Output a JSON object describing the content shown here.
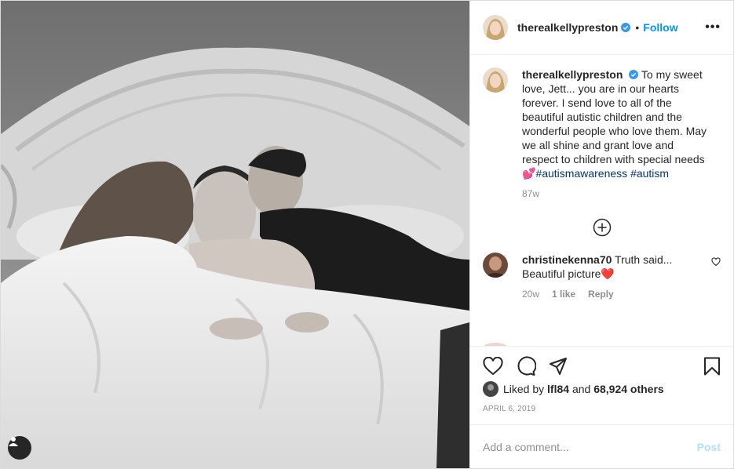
{
  "header": {
    "username": "therealkellypreston",
    "separator": "•",
    "follow_label": "Follow",
    "more_label": "•••"
  },
  "caption": {
    "username": "therealkellypreston",
    "text": "To my sweet love, Jett... you are in our hearts forever. I send love to all of the beautiful autistic children and the wonderful people who love them. May we all shine and grant love and respect to children with special needs",
    "emoji": "💕",
    "hashtags": [
      "#autismawareness",
      "#autism"
    ],
    "age": "87w"
  },
  "comment": {
    "username": "christinekenna70",
    "text": "Truth said... Beautiful picture",
    "emoji": "❤️",
    "age": "20w",
    "likes": "1 like",
    "reply_label": "Reply"
  },
  "likes": {
    "prefix": "Liked by",
    "user": "lfl84",
    "connector": "and",
    "count": "68,924 others"
  },
  "date": "APRIL 6, 2019",
  "add_comment": {
    "placeholder": "Add a comment...",
    "post_label": "Post"
  },
  "colors": {
    "accent": "#0095f6",
    "hashtag": "#00376b",
    "muted": "#8e8e8e",
    "post_disabled": "#b2dffc"
  }
}
